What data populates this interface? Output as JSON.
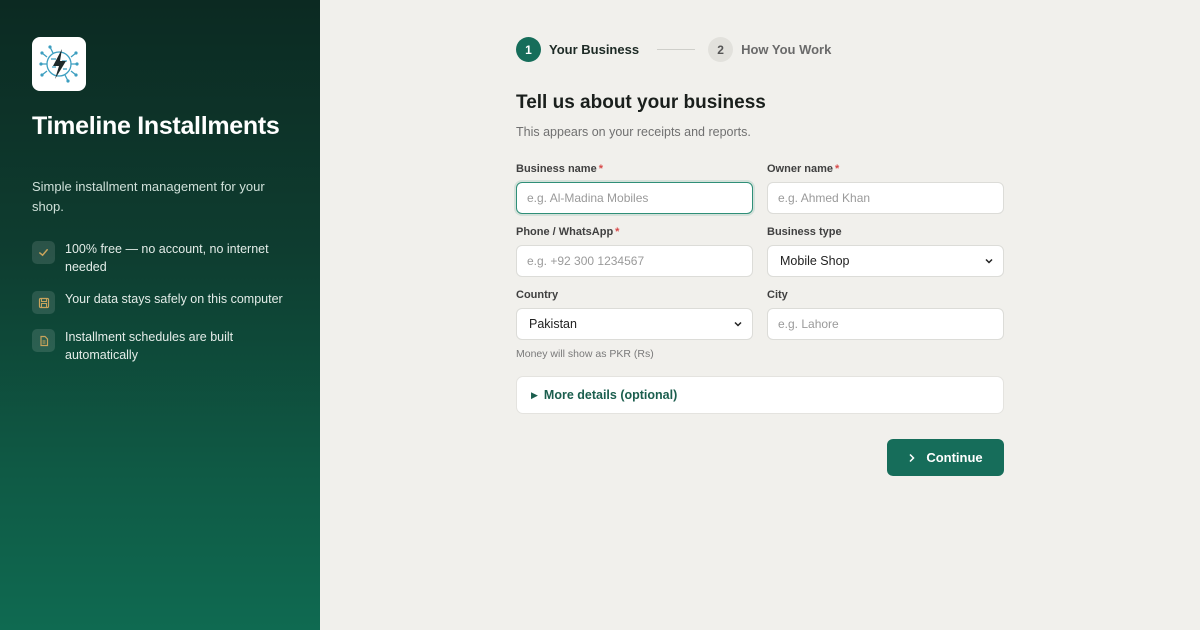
{
  "sidebar": {
    "app_name": "Timeline Installments",
    "tagline": "Simple installment management for your shop.",
    "features": [
      {
        "icon": "check-icon",
        "text": "100% free — no account, no internet needed"
      },
      {
        "icon": "save-icon",
        "text": "Your data stays safely on this computer"
      },
      {
        "icon": "document-icon",
        "text": "Installment schedules are built automatically"
      }
    ]
  },
  "stepper": {
    "steps": [
      {
        "number": "1",
        "label": "Your Business",
        "active": true
      },
      {
        "number": "2",
        "label": "How You Work",
        "active": false
      }
    ]
  },
  "form": {
    "title": "Tell us about your business",
    "subtitle": "This appears on your receipts and reports.",
    "business_name": {
      "label": "Business name",
      "placeholder": "e.g. Al-Madina Mobiles",
      "value": "",
      "required": "*"
    },
    "owner_name": {
      "label": "Owner name",
      "placeholder": "e.g. Ahmed Khan",
      "value": "",
      "required": "*"
    },
    "phone": {
      "label": "Phone / WhatsApp",
      "placeholder": "e.g. +92 300 1234567",
      "value": "",
      "required": "*"
    },
    "business_type": {
      "label": "Business type",
      "value": "Mobile Shop"
    },
    "country": {
      "label": "Country",
      "value": "Pakistan"
    },
    "city": {
      "label": "City",
      "placeholder": "e.g. Lahore",
      "value": ""
    },
    "currency_hint": "Money will show as PKR (Rs)",
    "more_details": "More details (optional)",
    "continue_label": "Continue"
  },
  "colors": {
    "accent": "#166d5a",
    "sidebar_top": "#0c2a22",
    "sidebar_bottom": "#0f6a51",
    "background": "#f1f0ec",
    "required": "#d84a4a"
  }
}
